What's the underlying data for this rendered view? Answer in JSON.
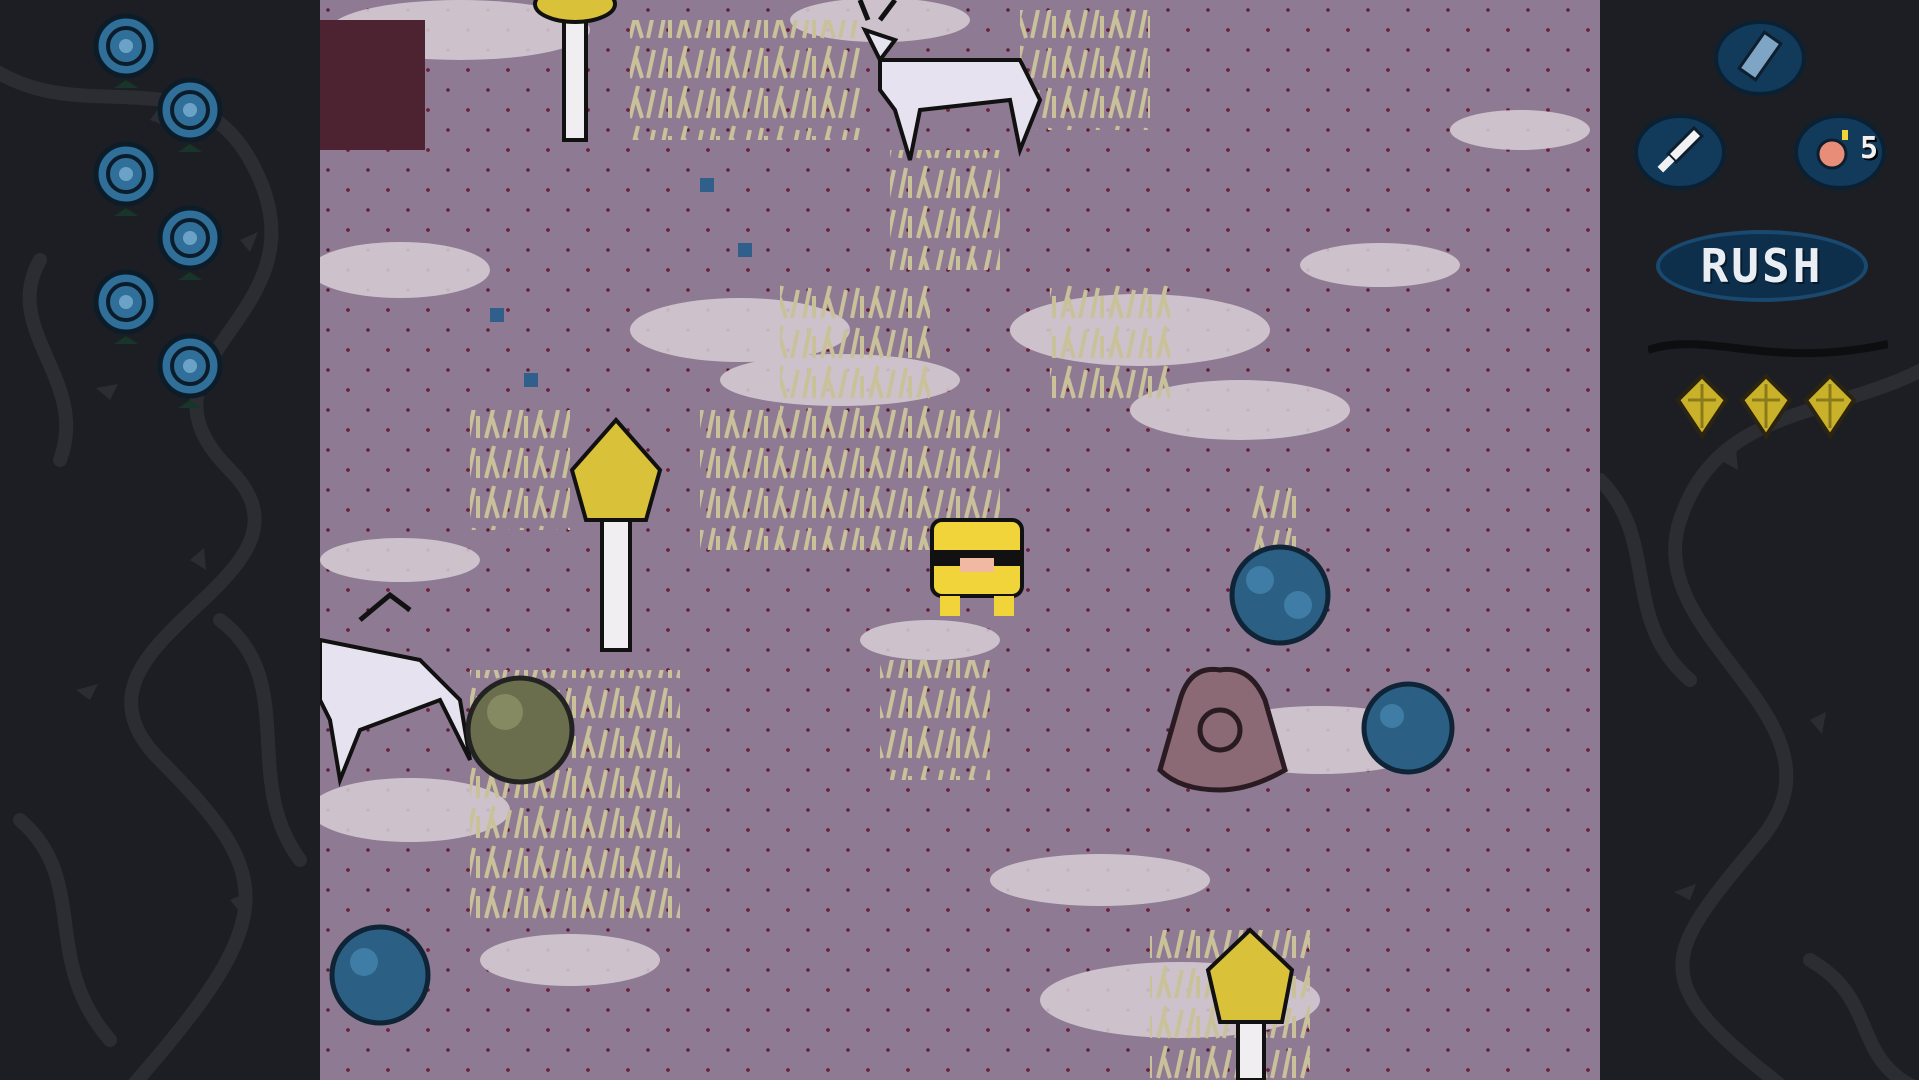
{
  "hud": {
    "health": {
      "label": "health-roses",
      "current": 6,
      "icon": "blue-rose-icon",
      "color": "#2f6f9a"
    },
    "items": [
      {
        "name": "crystal-item",
        "icon": "crystal-shard-icon"
      },
      {
        "name": "sword-item",
        "icon": "sword-icon"
      },
      {
        "name": "bomb-item",
        "icon": "bomb-icon",
        "count": "5"
      }
    ],
    "rush_label": "RUSH",
    "seeds": {
      "current": 3,
      "icon": "yellow-seed-icon",
      "color": "#c9b22a"
    }
  },
  "world": {
    "ground_color": "#8e7a92",
    "player": {
      "icon": "yellow-hero-icon"
    },
    "entities": [
      "white-deer-icon",
      "white-deer-icon",
      "yellow-tree-icon",
      "yellow-tree-icon",
      "yellow-tree-icon",
      "blue-rose-bush-icon",
      "blue-rose-bush-icon",
      "blue-rose-bush-icon",
      "mossy-boulder-icon",
      "stone-shrine-icon"
    ]
  }
}
